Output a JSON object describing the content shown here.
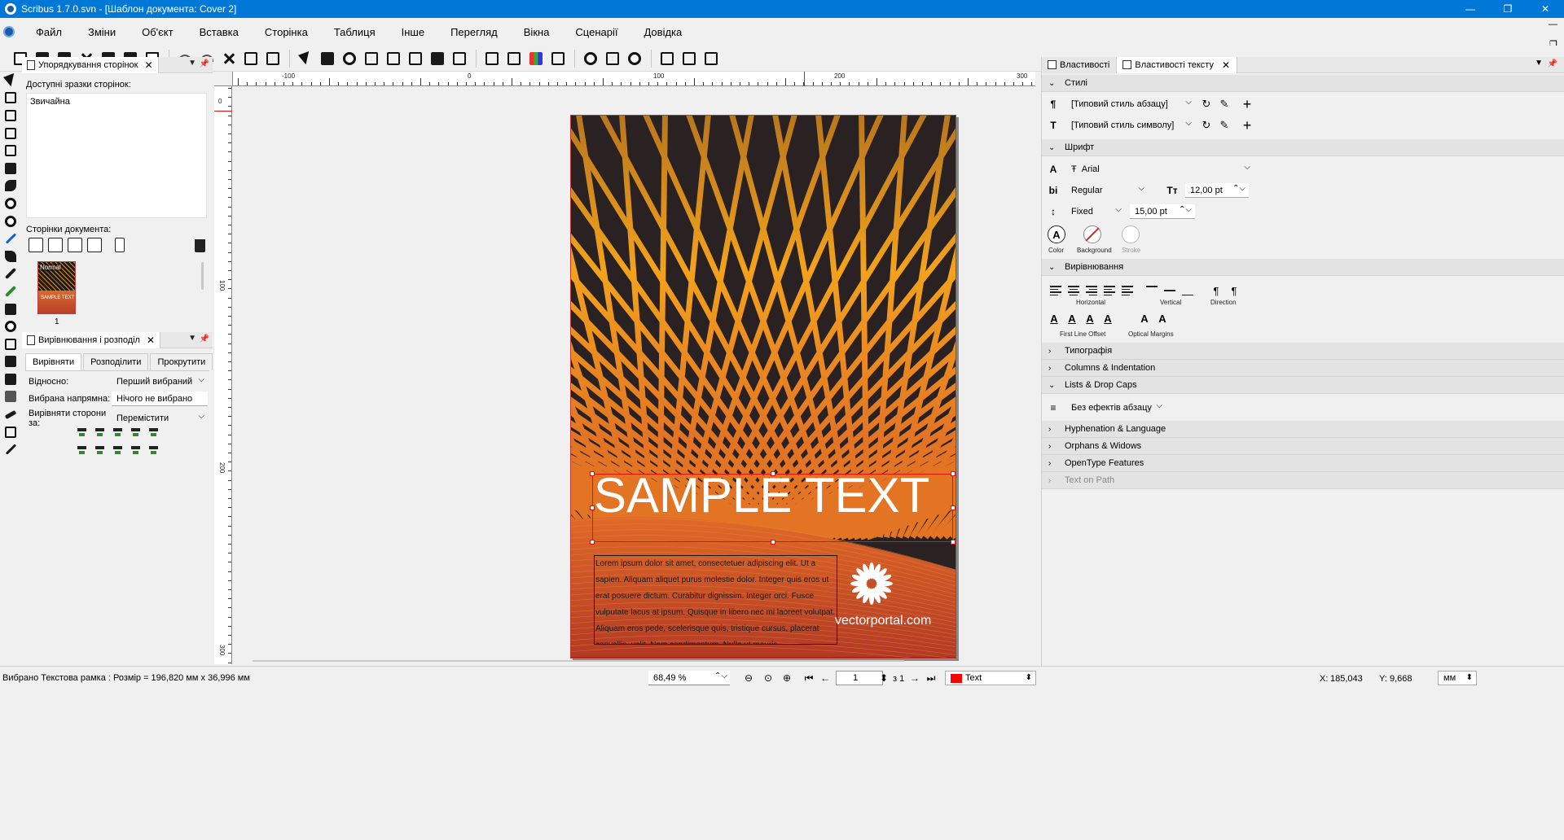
{
  "window": {
    "title": "Scribus 1.7.0.svn - [Шаблон документа: Cover 2]",
    "controls": [
      "—",
      "❐",
      "✕"
    ]
  },
  "menu": [
    "Файл",
    "Зміни",
    "Об'єкт",
    "Вставка",
    "Сторінка",
    "Таблиця",
    "Інше",
    "Перегляд",
    "Вікна",
    "Сценарії",
    "Довідка"
  ],
  "mdi_controls": [
    "—",
    "❐",
    "✕"
  ],
  "left_panel_pages": {
    "tab_label": "Упорядкування сторінок",
    "available_label": "Доступні зразки сторінок:",
    "masters": [
      "Звичайна"
    ],
    "document_pages_label": "Сторінки документа:",
    "thumb_badge": "Normal",
    "thumb_text": "SAMPLE TEXT",
    "thumb_page_number": "1"
  },
  "left_panel_align": {
    "tab_label": "Вирівнювання і розподіл",
    "tabs": [
      "Вирівняти",
      "Розподілити",
      "Прокрутити"
    ],
    "relative_label": "Відносно:",
    "relative_value": "Перший вибраний",
    "guide_label": "Вибрана напрямна:",
    "guide_value": "Нічого не вибрано",
    "sides_label": "Вирівняти сторони за:",
    "sides_value": "Перемістити"
  },
  "ruler": {
    "h_labels": [
      "-100",
      "0",
      "100",
      "200",
      "300"
    ],
    "v_labels": [
      "0",
      "100",
      "200",
      "300"
    ]
  },
  "document": {
    "headline": "SAMPLE TEXT",
    "lorem": "Lorem ipsum dolor sit amet, consectetuer adipiscing elit. Ut a sapien. Aliquam aliquet purus molestie dolor. Integer quis eros ut erat posuere dictum. Curabitur dignissim. Integer orci. Fusce vulputate lacus at ipsum. Quisque in libero nec mi laoreet volutpat. Aliquam eros pede, scelerisque quis, tristique cursus, placerat convallis, velit. Nam condimentum. Nulla ut mauris.",
    "logo_text": "vectorportal.com"
  },
  "right_panel": {
    "tabs": [
      "Властивості",
      "Властивості тексту"
    ],
    "sections": {
      "styles": "Стилі",
      "font": "Шрифт",
      "alignment": "Вирівнювання",
      "typography": "Типографія",
      "columns": "Columns & Indentation",
      "lists": "Lists & Drop Caps",
      "hyphenation": "Hyphenation & Language",
      "orphans": "Orphans & Widows",
      "opentype": "OpenType Features",
      "text_on_path": "Text on Path"
    },
    "paragraph_style": "[Типовий стиль абзацу]",
    "character_style": "[Типовий стиль символу]",
    "font_family": "Arial",
    "font_style": "Regular",
    "font_size": "12,00 pt",
    "line_spacing_mode": "Fixed",
    "line_spacing": "15,00 pt",
    "color_labels": [
      "Color",
      "Background",
      "Stroke"
    ],
    "align_labels": [
      "Horizontal",
      "Vertical",
      "Direction"
    ],
    "offset_labels": [
      "First Line Offset",
      "Optical Margins"
    ],
    "drop_caps_value": "Без ефектів абзацу"
  },
  "status": {
    "selection": "Вибрано Текстова рамка : Розмір = 196,820 мм x 36,996 мм",
    "zoom": "68,49 %",
    "page": "1",
    "of": "з 1",
    "layer": "Text",
    "x_label": "X:",
    "x_value": "185,043",
    "y_label": "Y:",
    "y_value": "9,668",
    "unit": "мм"
  },
  "colors": {
    "titlebar": "#0078d7",
    "selection_frame": "#e31010",
    "page_dark": "#2a2222",
    "page_orange": "#d96b2a"
  }
}
